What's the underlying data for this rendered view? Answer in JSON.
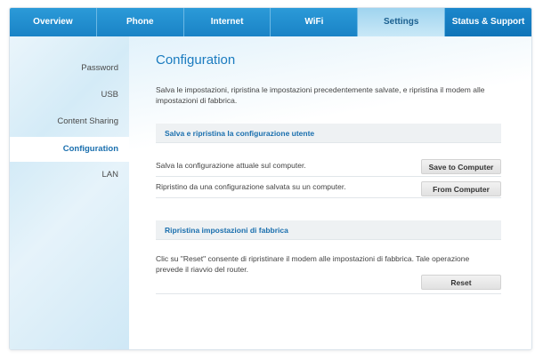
{
  "topnav": {
    "tabs": [
      {
        "label": "Overview"
      },
      {
        "label": "Phone"
      },
      {
        "label": "Internet"
      },
      {
        "label": "WiFi"
      },
      {
        "label": "Settings",
        "active": true
      },
      {
        "label": "Status & Support"
      }
    ]
  },
  "sidebar": {
    "items": [
      {
        "label": "Password"
      },
      {
        "label": "USB"
      },
      {
        "label": "Content Sharing"
      },
      {
        "label": "Configuration",
        "active": true
      },
      {
        "label": "LAN"
      }
    ]
  },
  "main": {
    "title": "Configuration",
    "intro": "Salva le impostazioni, ripristina le impostazioni precedentemente salvate, e ripristina il modem alle impostazioni di fabbrica.",
    "section_backup": {
      "header": "Salva e ripristina la configurazione utente",
      "rows": [
        {
          "text": "Salva la configurazione attuale sul computer.",
          "button": "Save to Computer"
        },
        {
          "text": "Ripristino da una configurazione salvata su un computer.",
          "button": "From Computer"
        }
      ]
    },
    "section_factory": {
      "header": "Ripristina impostazioni di fabbrica",
      "text": "Clic su \"Reset\" consente di ripristinare il modem alle impostazioni di fabbrica. Tale operazione prevede il riavvio del router.",
      "button": "Reset"
    }
  },
  "colors": {
    "nav_blue": "#1a83c6",
    "active_tab": "#c9e8f7",
    "title_blue": "#1a7bbf",
    "section_header_bg": "#eef1f3"
  }
}
